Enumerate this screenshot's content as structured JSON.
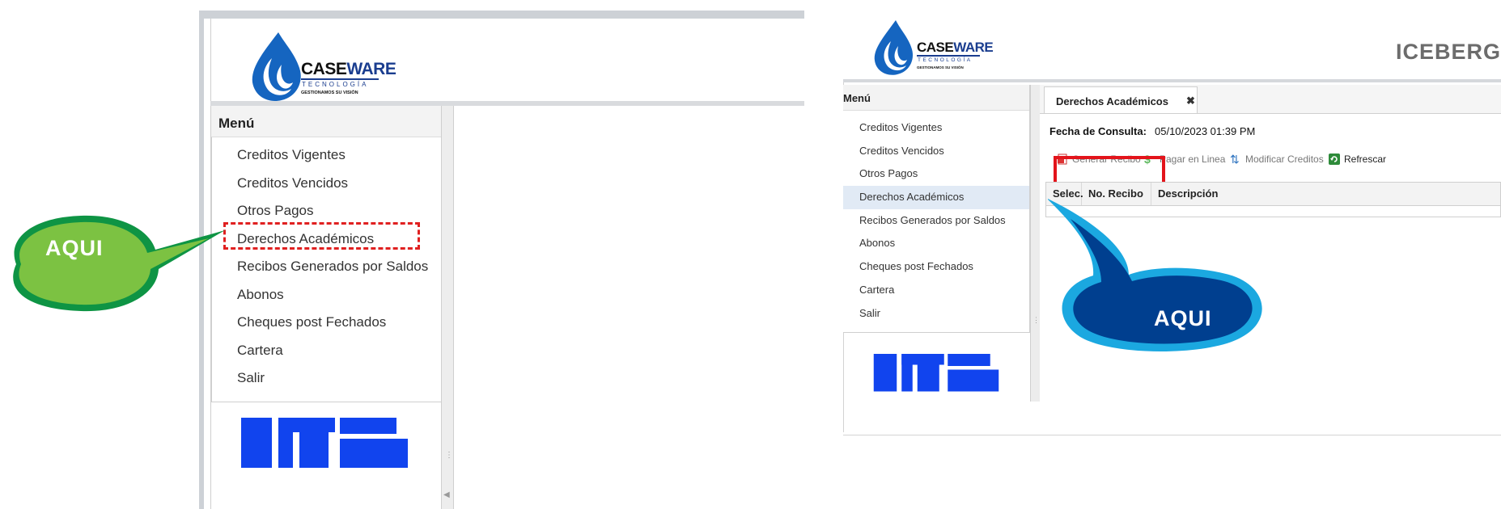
{
  "left_screen": {
    "brand": {
      "name_part1": "CASE",
      "name_part2": "WARE",
      "sub": "TECNOLOGÍA",
      "slogan": "GESTIONAMOS SU VISIÓN"
    },
    "menu_title": "Menú",
    "menu_items": [
      "Creditos Vigentes",
      "Creditos Vencidos",
      "Otros Pagos",
      "Derechos Académicos",
      "Recibos Generados por Saldos",
      "Abonos",
      "Cheques post Fechados",
      "Cartera",
      "Salir"
    ],
    "highlighted_item": "Derechos Académicos"
  },
  "right_screen": {
    "brand": {
      "name_part1": "CASE",
      "name_part2": "WARE",
      "sub": "TECNOLOGÍA",
      "slogan": "GESTIONAMOS SU VISIÓN"
    },
    "app_title": "ICEBERG",
    "menu_title": "Menú",
    "menu_items": [
      "Creditos Vigentes",
      "Creditos Vencidos",
      "Otros Pagos",
      "Derechos Académicos",
      "Recibos Generados por Saldos",
      "Abonos",
      "Cheques post Fechados",
      "Cartera",
      "Salir"
    ],
    "active_item": "Derechos Académicos",
    "tab": {
      "label": "Derechos Académicos",
      "close": "✖"
    },
    "fecha": {
      "label": "Fecha de Consulta:",
      "value": "05/10/2023  01:39  PM"
    },
    "toolbar": {
      "generar": "Generar Recibo",
      "pagar": "Pagar en Linea",
      "modificar": "Modificar Creditos",
      "refrescar": "Refrescar"
    },
    "grid_columns": [
      "Selec.",
      "No. Recibo",
      "Descripción"
    ]
  },
  "callouts": {
    "green": "AQUI",
    "blue": "AQUI"
  },
  "colors": {
    "green": "#7cc242",
    "green_dark": "#0e9444",
    "blue": "#003f8f",
    "blue_light": "#1ba8e0",
    "red_box": "#e3141b",
    "caseware_blue": "#1a3d8f",
    "utb_blue": "#1144ee"
  }
}
